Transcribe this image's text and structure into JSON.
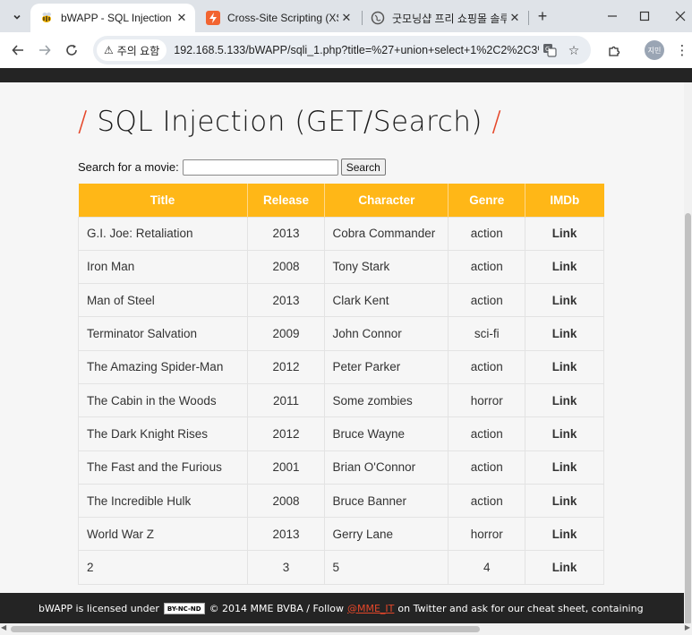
{
  "browser": {
    "tabs": [
      {
        "title": "bWAPP - SQL Injection",
        "active": true,
        "favicon": "bee-icon"
      },
      {
        "title": "Cross-Site Scripting (XSS)",
        "active": false,
        "favicon": "lightning-icon"
      },
      {
        "title": "굿모닝샵 프리 쇼핑몰 솔루",
        "active": false,
        "favicon": "globe-icon"
      }
    ],
    "security_label": "주의 요함",
    "url": "192.168.5.133/bWAPP/sqli_1.php?title=%27+union+select+1%2C2%2C3%...",
    "profile_label": "지민"
  },
  "page": {
    "heading": "SQL Injection (GET/Search)",
    "search_label": "Search for a movie:",
    "search_value": "",
    "search_button": "Search",
    "columns": [
      "Title",
      "Release",
      "Character",
      "Genre",
      "IMDb"
    ],
    "rows": [
      {
        "title": "G.I. Joe: Retaliation",
        "release": "2013",
        "character": "Cobra Commander",
        "genre": "action",
        "imdb": "Link"
      },
      {
        "title": "Iron Man",
        "release": "2008",
        "character": "Tony Stark",
        "genre": "action",
        "imdb": "Link"
      },
      {
        "title": "Man of Steel",
        "release": "2013",
        "character": "Clark Kent",
        "genre": "action",
        "imdb": "Link"
      },
      {
        "title": "Terminator Salvation",
        "release": "2009",
        "character": "John Connor",
        "genre": "sci-fi",
        "imdb": "Link"
      },
      {
        "title": "The Amazing Spider-Man",
        "release": "2012",
        "character": "Peter Parker",
        "genre": "action",
        "imdb": "Link"
      },
      {
        "title": "The Cabin in the Woods",
        "release": "2011",
        "character": "Some zombies",
        "genre": "horror",
        "imdb": "Link"
      },
      {
        "title": "The Dark Knight Rises",
        "release": "2012",
        "character": "Bruce Wayne",
        "genre": "action",
        "imdb": "Link"
      },
      {
        "title": "The Fast and the Furious",
        "release": "2001",
        "character": "Brian O'Connor",
        "genre": "action",
        "imdb": "Link"
      },
      {
        "title": "The Incredible Hulk",
        "release": "2008",
        "character": "Bruce Banner",
        "genre": "action",
        "imdb": "Link"
      },
      {
        "title": "World War Z",
        "release": "2013",
        "character": "Gerry Lane",
        "genre": "horror",
        "imdb": "Link"
      },
      {
        "title": "2",
        "release": "3",
        "character": "5",
        "genre": "4",
        "imdb": "Link"
      }
    ],
    "footer": {
      "text_before": "bWAPP is licensed under",
      "cc_badge": "BY-NC-ND",
      "text_middle": "© 2014 MME BVBA / Follow",
      "twitter": "@MME_IT",
      "text_after": "on Twitter and ask for our cheat sheet, containing"
    }
  },
  "colors": {
    "accent": "#e5472a",
    "table_header": "#ffb717",
    "dark_bar": "#242424"
  }
}
